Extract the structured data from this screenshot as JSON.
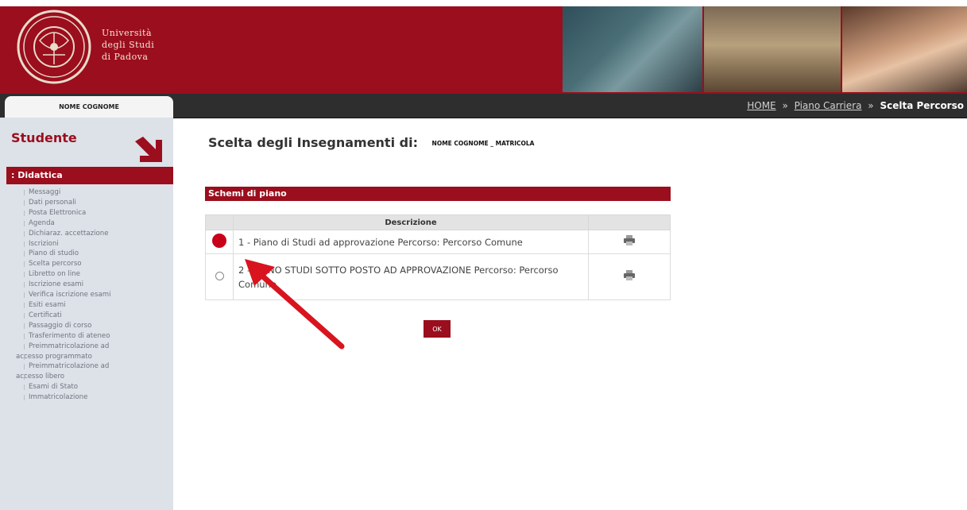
{
  "header": {
    "university_lines": [
      "Università",
      "degli Studi",
      "di Padova"
    ]
  },
  "nav": {
    "user_tab": "NOME COGNOME",
    "breadcrumb": [
      "HOME",
      "Piano Carriera",
      "Scelta Percorso"
    ],
    "breadcrumb_sep": "»"
  },
  "sidebar": {
    "title": "Studente",
    "section": ": Didattica",
    "items": [
      "Messaggi",
      "Dati personali",
      "Posta Elettronica",
      "Agenda",
      "Dichiaraz. accettazione",
      "Iscrizioni",
      "Piano di studio",
      "Scelta percorso",
      "Libretto on line",
      "Iscrizione esami",
      "Verifica iscrizione esami",
      "Esiti esami",
      "Certificati",
      "Passaggio di corso",
      "Trasferimento di ateneo",
      "Preimmatricolazione ad",
      "accesso programmato",
      "Preimmatricolazione ad",
      "accesso libero",
      "Esami di Stato",
      "Immatricolazione"
    ]
  },
  "main": {
    "title": "Scelta degli Insegnamenti di:",
    "student_id": "NOME COGNOME _ MATRICOLA",
    "section_bar": "Schemi di piano",
    "table": {
      "header": "Descrizione",
      "rows": [
        {
          "description": "1 - Piano di Studi ad approvazione Percorso: Percorso Comune",
          "selected": true
        },
        {
          "description": "2 - PIANO STUDI SOTTO POSTO AD APPROVAZIONE Percorso: Percorso Comune",
          "selected": false
        }
      ]
    },
    "ok_label": "OK"
  },
  "colors": {
    "brand_red": "#9b0e1d",
    "nav_dark": "#2e2e2e",
    "sidebar_bg": "#dde1e8",
    "annotation_red": "#d8141f"
  },
  "icons": {
    "print": "printer-icon",
    "seal": "university-seal-icon",
    "sidebar_arrow": "arrow-down-right-icon"
  }
}
